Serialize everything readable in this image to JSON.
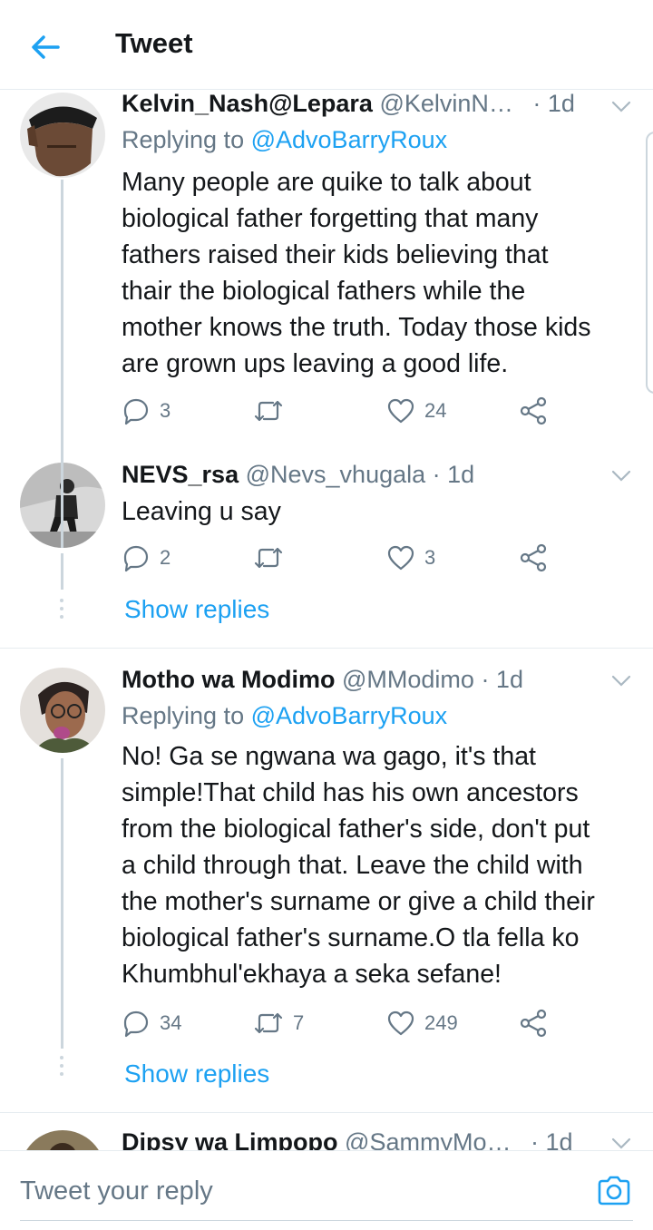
{
  "header": {
    "title": "Tweet"
  },
  "tweets": [
    {
      "name": "Kelvin_Nash@Lepara",
      "handle": "@KelvinN…",
      "time": "· 1d",
      "replying_label": "Replying to",
      "replying_to": "@AdvoBarryRoux",
      "lines": [
        "Many people are quike to talk about",
        "biological father forgetting that many",
        "fathers raised their kids believing that",
        "thair the biological fathers while the",
        "mother knows the truth. Today those kids",
        "are grown ups leaving a good life."
      ],
      "replies": "3",
      "retweets": "",
      "likes": "24"
    },
    {
      "name": "NEVS_rsa",
      "handle": "@Nevs_vhugala",
      "time": "· 1d",
      "lines": [
        "Leaving u say"
      ],
      "replies": "2",
      "retweets": "",
      "likes": "3",
      "show_replies": "Show replies"
    },
    {
      "name": "Motho wa Modimo",
      "handle": "@MModimo",
      "time": "· 1d",
      "replying_label": "Replying to",
      "replying_to": "@AdvoBarryRoux",
      "lines": [
        "No! Ga se ngwana wa gago, it's that",
        "simple!That child has his own ancestors",
        "from the biological father's side, don't put",
        "a child through that. Leave the child with",
        "the mother's surname or give a child their",
        "biological father's surname.O tla fella ko",
        "Khumbhul'ekhaya a seka sefane!"
      ],
      "replies": "34",
      "retweets": "7",
      "likes": "249",
      "show_replies": "Show replies"
    },
    {
      "name": "Dipsy wa Limpopo",
      "handle": "@SammyMo…",
      "time": "· 1d"
    }
  ],
  "composer": {
    "placeholder": "Tweet your reply"
  },
  "colors": {
    "accent": "#1da1f2",
    "text": "#14171a",
    "secondary": "#657786",
    "border": "#e6ecf0"
  }
}
